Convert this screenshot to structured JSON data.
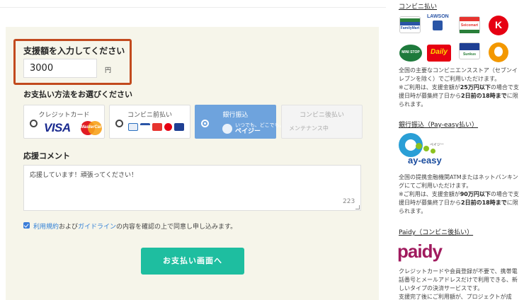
{
  "form": {
    "amount_label": "支援額を入力してください",
    "amount_value": "3000",
    "amount_unit": "円",
    "method_heading": "お支払い方法をお選びください",
    "methods": [
      {
        "title": "クレジットカード",
        "logos": [
          "VISA",
          "MasterCard"
        ],
        "selected": false
      },
      {
        "title": "コンビニ前払い",
        "selected": false
      },
      {
        "title": "銀行振込",
        "logo_caption": "いつでも、どこでも。",
        "logo_name": "ペイジー",
        "selected": true
      },
      {
        "title": "コンビニ後払い",
        "note": "メンテナンス中",
        "disabled": true
      }
    ],
    "comment_heading": "応援コメント",
    "comment_value": "応援しています！頑張ってください！",
    "comment_counter": "223",
    "agree_link1": "利用規約",
    "agree_mid": "および",
    "agree_link2": "ガイドライン",
    "agree_tail": "の内容を確認の上で同意し申し込みます。",
    "agree_checked": true,
    "submit_label": "お支払い画面へ"
  },
  "sidebar": {
    "convenience": {
      "link": "コンビニ払い",
      "stores": [
        "FamilyMart",
        "LAWSON",
        "Seicomart",
        "Circle K",
        "MINI STOP",
        "Daily",
        "Sunkus",
        "Sunkus"
      ],
      "desc": "全国の主要なコンビニエンスストア（セブンイレブンを除く）でご利用いただけます。",
      "note_pre": "※ご利用は、支援金額が",
      "note_amount": "25万円以下",
      "note_mid": "の場合で支援日時が募集終了日から",
      "note_deadline": "2日前の18時まで",
      "note_tail": "に限られます。"
    },
    "payeasy": {
      "link": "銀行振込（Pay-easy払い）",
      "logo_text": "ay-easy",
      "logo_sub": "ペイジー",
      "desc": "全国の提携金融機関ATMまたはネットバンキングにてご利用いただけます。",
      "note_pre": "※ご利用は、支援金額が",
      "note_amount": "90万円以下",
      "note_mid": "の場合で支援日時が募集終了日から",
      "note_deadline": "2日前の18時まで",
      "note_tail": "に限られます。"
    },
    "paidy": {
      "link": "Paidy（コンビニ後払い）",
      "logo_text": "paidy",
      "desc": "クレジットカードや会員登録が不要で、携帯電話番号とメールアドレスだけで利用できる、新しいタイプの決済サービスです。",
      "desc_cut": "支援完了後にご利用額が、プロジェクトが成"
    }
  },
  "colors": {
    "panel_bg": "#f6f5ea",
    "highlight_border": "#c24a1e",
    "selected_method": "#6ea3dd",
    "submit": "#1ebea0",
    "link": "#2f7fd6"
  }
}
